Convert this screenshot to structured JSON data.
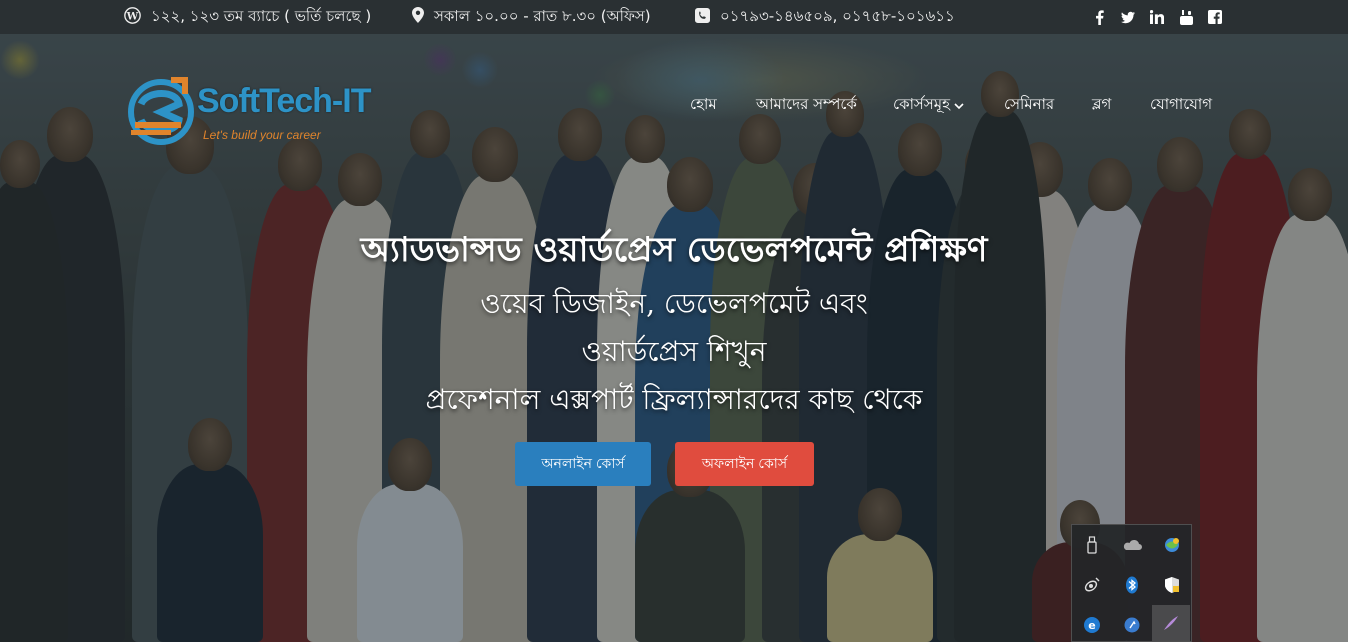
{
  "topbar": {
    "batch_text": "১২২, ১২৩ তম ব্যাচে ( ভর্তি চলছে )",
    "hours_text": "সকাল ১০.০০ - রাত ৮.৩০ (অফিস)",
    "phone_text": "০১৭৯৩-১৪৬৫০৯, ০১৭৫৮-১০১৬১১",
    "social_icons": [
      "facebook-icon",
      "twitter-icon",
      "linkedin-icon",
      "youtube-icon",
      "facebook-square-icon"
    ]
  },
  "logo": {
    "name": "SoftTech-IT",
    "tagline": "Let's build your career"
  },
  "nav": {
    "items": [
      {
        "label": "হোম"
      },
      {
        "label": "আমাদের সম্পর্কে"
      },
      {
        "label": "কোর্সসমূহ"
      },
      {
        "label": "সেমিনার"
      },
      {
        "label": "ব্লগ"
      },
      {
        "label": "যোগাযোগ"
      }
    ]
  },
  "hero": {
    "title": "অ্যাডভান্সড ওয়ার্ডপ্রেস ডেভেলপমেন্ট প্রশিক্ষণ",
    "line1": "ওয়েব ডিজাইন, ডেভেলপমেট এবং",
    "line2": "ওয়ার্ডপ্রেস শিখুন",
    "line3": "প্রফেশনাল এক্সপার্ট ফ্রিল্যান্সারদের কাছ থেকে",
    "online_button": "অনলাইন কোর্স",
    "offline_button": "অফলাইন কোর্স",
    "online_color": "#2a7fbe",
    "offline_color": "#e04c3e"
  },
  "tray": {
    "icons": [
      "usb-drive-icon",
      "onedrive-cloud-icon",
      "network-globe-icon",
      "satellite-icon",
      "bluetooth-icon",
      "security-shield-icon",
      "edge-browser-icon",
      "chat-icon",
      "pen-feather-icon"
    ]
  }
}
